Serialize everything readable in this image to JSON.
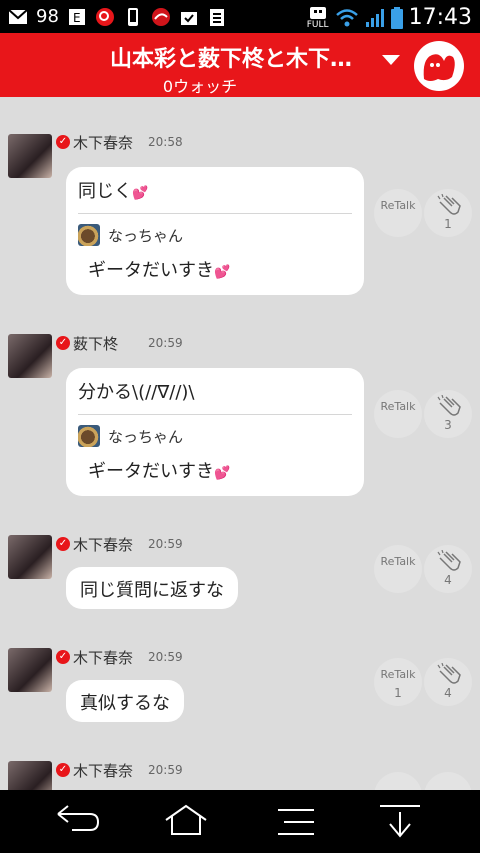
{
  "statusbar": {
    "battery_level": "98",
    "time": "17:43",
    "network_label": "FULL"
  },
  "header": {
    "title": "山本彩と薮下柊と木下…",
    "subtitle": "0ウォッチ"
  },
  "messages": [
    {
      "name": "木下春奈",
      "time": "20:58",
      "text": "同じく",
      "heart": "💕",
      "quote": {
        "name": "なっちゃん",
        "text": "ギータだいすき",
        "heart": "💕"
      },
      "retalk_label": "ReTalk",
      "retalk_count": "",
      "clap_count": "1"
    },
    {
      "name": "薮下柊",
      "time": "20:59",
      "text": "分かる\\(//∇//)\\",
      "heart": "",
      "quote": {
        "name": "なっちゃん",
        "text": "ギータだいすき",
        "heart": "💕"
      },
      "retalk_label": "ReTalk",
      "retalk_count": "",
      "clap_count": "3"
    },
    {
      "name": "木下春奈",
      "time": "20:59",
      "text": "同じ質問に返すな",
      "retalk_label": "ReTalk",
      "retalk_count": "",
      "clap_count": "4"
    },
    {
      "name": "木下春奈",
      "time": "20:59",
      "text": "真似するな",
      "retalk_label": "ReTalk",
      "retalk_count": "1",
      "clap_count": "4"
    },
    {
      "name": "木下春奈",
      "time": "20:59"
    }
  ]
}
